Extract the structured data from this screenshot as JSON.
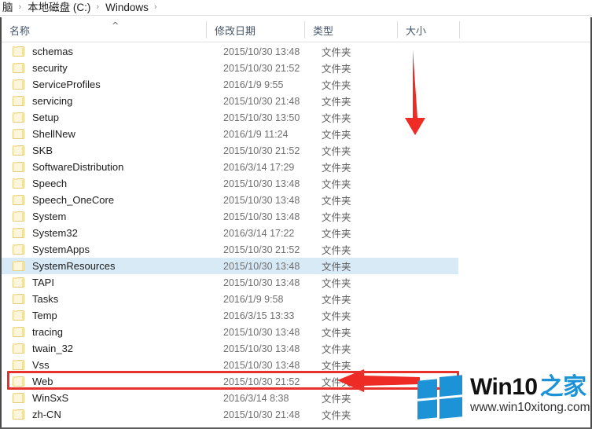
{
  "window": {
    "frame_color": "#4a4a4a"
  },
  "breadcrumb": {
    "items": [
      "脑",
      "本地磁盘 (C:)",
      "Windows"
    ],
    "separator": "›",
    "trailing_separator": "›"
  },
  "columns": {
    "name": "名称",
    "date_modified": "修改日期",
    "type": "类型",
    "size": "大小",
    "sort_indicator": "^"
  },
  "files": [
    {
      "name": "schemas",
      "date": "2015/10/30 13:48",
      "type": "文件夹",
      "size": "",
      "selected": false
    },
    {
      "name": "security",
      "date": "2015/10/30 21:52",
      "type": "文件夹",
      "size": "",
      "selected": false
    },
    {
      "name": "ServiceProfiles",
      "date": "2016/1/9 9:55",
      "type": "文件夹",
      "size": "",
      "selected": false
    },
    {
      "name": "servicing",
      "date": "2015/10/30 21:48",
      "type": "文件夹",
      "size": "",
      "selected": false
    },
    {
      "name": "Setup",
      "date": "2015/10/30 13:50",
      "type": "文件夹",
      "size": "",
      "selected": false
    },
    {
      "name": "ShellNew",
      "date": "2016/1/9 11:24",
      "type": "文件夹",
      "size": "",
      "selected": false
    },
    {
      "name": "SKB",
      "date": "2015/10/30 21:52",
      "type": "文件夹",
      "size": "",
      "selected": false
    },
    {
      "name": "SoftwareDistribution",
      "date": "2016/3/14 17:29",
      "type": "文件夹",
      "size": "",
      "selected": false
    },
    {
      "name": "Speech",
      "date": "2015/10/30 13:48",
      "type": "文件夹",
      "size": "",
      "selected": false
    },
    {
      "name": "Speech_OneCore",
      "date": "2015/10/30 13:48",
      "type": "文件夹",
      "size": "",
      "selected": false
    },
    {
      "name": "System",
      "date": "2015/10/30 13:48",
      "type": "文件夹",
      "size": "",
      "selected": false
    },
    {
      "name": "System32",
      "date": "2016/3/14 17:22",
      "type": "文件夹",
      "size": "",
      "selected": false
    },
    {
      "name": "SystemApps",
      "date": "2015/10/30 21:52",
      "type": "文件夹",
      "size": "",
      "selected": false
    },
    {
      "name": "SystemResources",
      "date": "2015/10/30 13:48",
      "type": "文件夹",
      "size": "",
      "selected": true
    },
    {
      "name": "TAPI",
      "date": "2015/10/30 13:48",
      "type": "文件夹",
      "size": "",
      "selected": false
    },
    {
      "name": "Tasks",
      "date": "2016/1/9 9:58",
      "type": "文件夹",
      "size": "",
      "selected": false
    },
    {
      "name": "Temp",
      "date": "2016/3/15 13:33",
      "type": "文件夹",
      "size": "",
      "selected": false
    },
    {
      "name": "tracing",
      "date": "2015/10/30 13:48",
      "type": "文件夹",
      "size": "",
      "selected": false
    },
    {
      "name": "twain_32",
      "date": "2015/10/30 13:48",
      "type": "文件夹",
      "size": "",
      "selected": false
    },
    {
      "name": "Vss",
      "date": "2015/10/30 13:48",
      "type": "文件夹",
      "size": "",
      "selected": false
    },
    {
      "name": "Web",
      "date": "2015/10/30 21:52",
      "type": "文件夹",
      "size": "",
      "selected": false
    },
    {
      "name": "WinSxS",
      "date": "2016/3/14 8:38",
      "type": "文件夹",
      "size": "",
      "selected": false
    },
    {
      "name": "zh-CN",
      "date": "2015/10/30 21:48",
      "type": "文件夹",
      "size": "",
      "selected": false
    }
  ],
  "annotations": {
    "color": "#e8312b",
    "down_arrow": {
      "target_hint": "scroll down through list"
    },
    "left_arrow": {
      "target_hint": "Web folder row"
    },
    "highlight_box": {
      "target_row": "Web"
    }
  },
  "watermark": {
    "title_en": "Win10",
    "title_cn": "之家",
    "url": "www.win10xitong.com",
    "logo_color": "#1c93d6"
  }
}
